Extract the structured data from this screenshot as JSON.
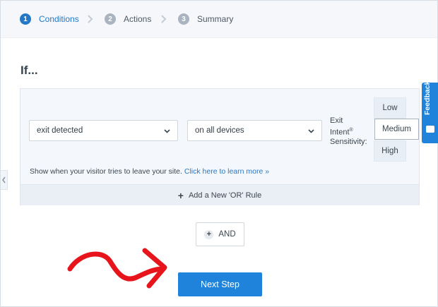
{
  "stepper": {
    "steps": [
      {
        "num": "1",
        "label": "Conditions"
      },
      {
        "num": "2",
        "label": "Actions"
      },
      {
        "num": "3",
        "label": "Summary"
      }
    ]
  },
  "heading": "If...",
  "rule": {
    "condition_select": "exit detected",
    "device_select": "on all devices",
    "sensitivity_label_line1": "Exit",
    "sensitivity_label_line2": "Intent",
    "sensitivity_label_sup": "®",
    "sensitivity_label_line3": "Sensitivity:",
    "sensitivity_options": [
      "Low",
      "Medium",
      "High"
    ],
    "sensitivity_selected": "Medium",
    "help_text": "Show when your visitor tries to leave your site.",
    "help_link": "Click here to learn more »",
    "add_or_rule": "Add a New 'OR' Rule"
  },
  "and_button": "AND",
  "next_button": "Next Step",
  "feedback_tab": "Feedback",
  "colors": {
    "accent": "#1f83dc",
    "active_step": "#2379c8",
    "annotation_arrow": "#e8141c"
  }
}
